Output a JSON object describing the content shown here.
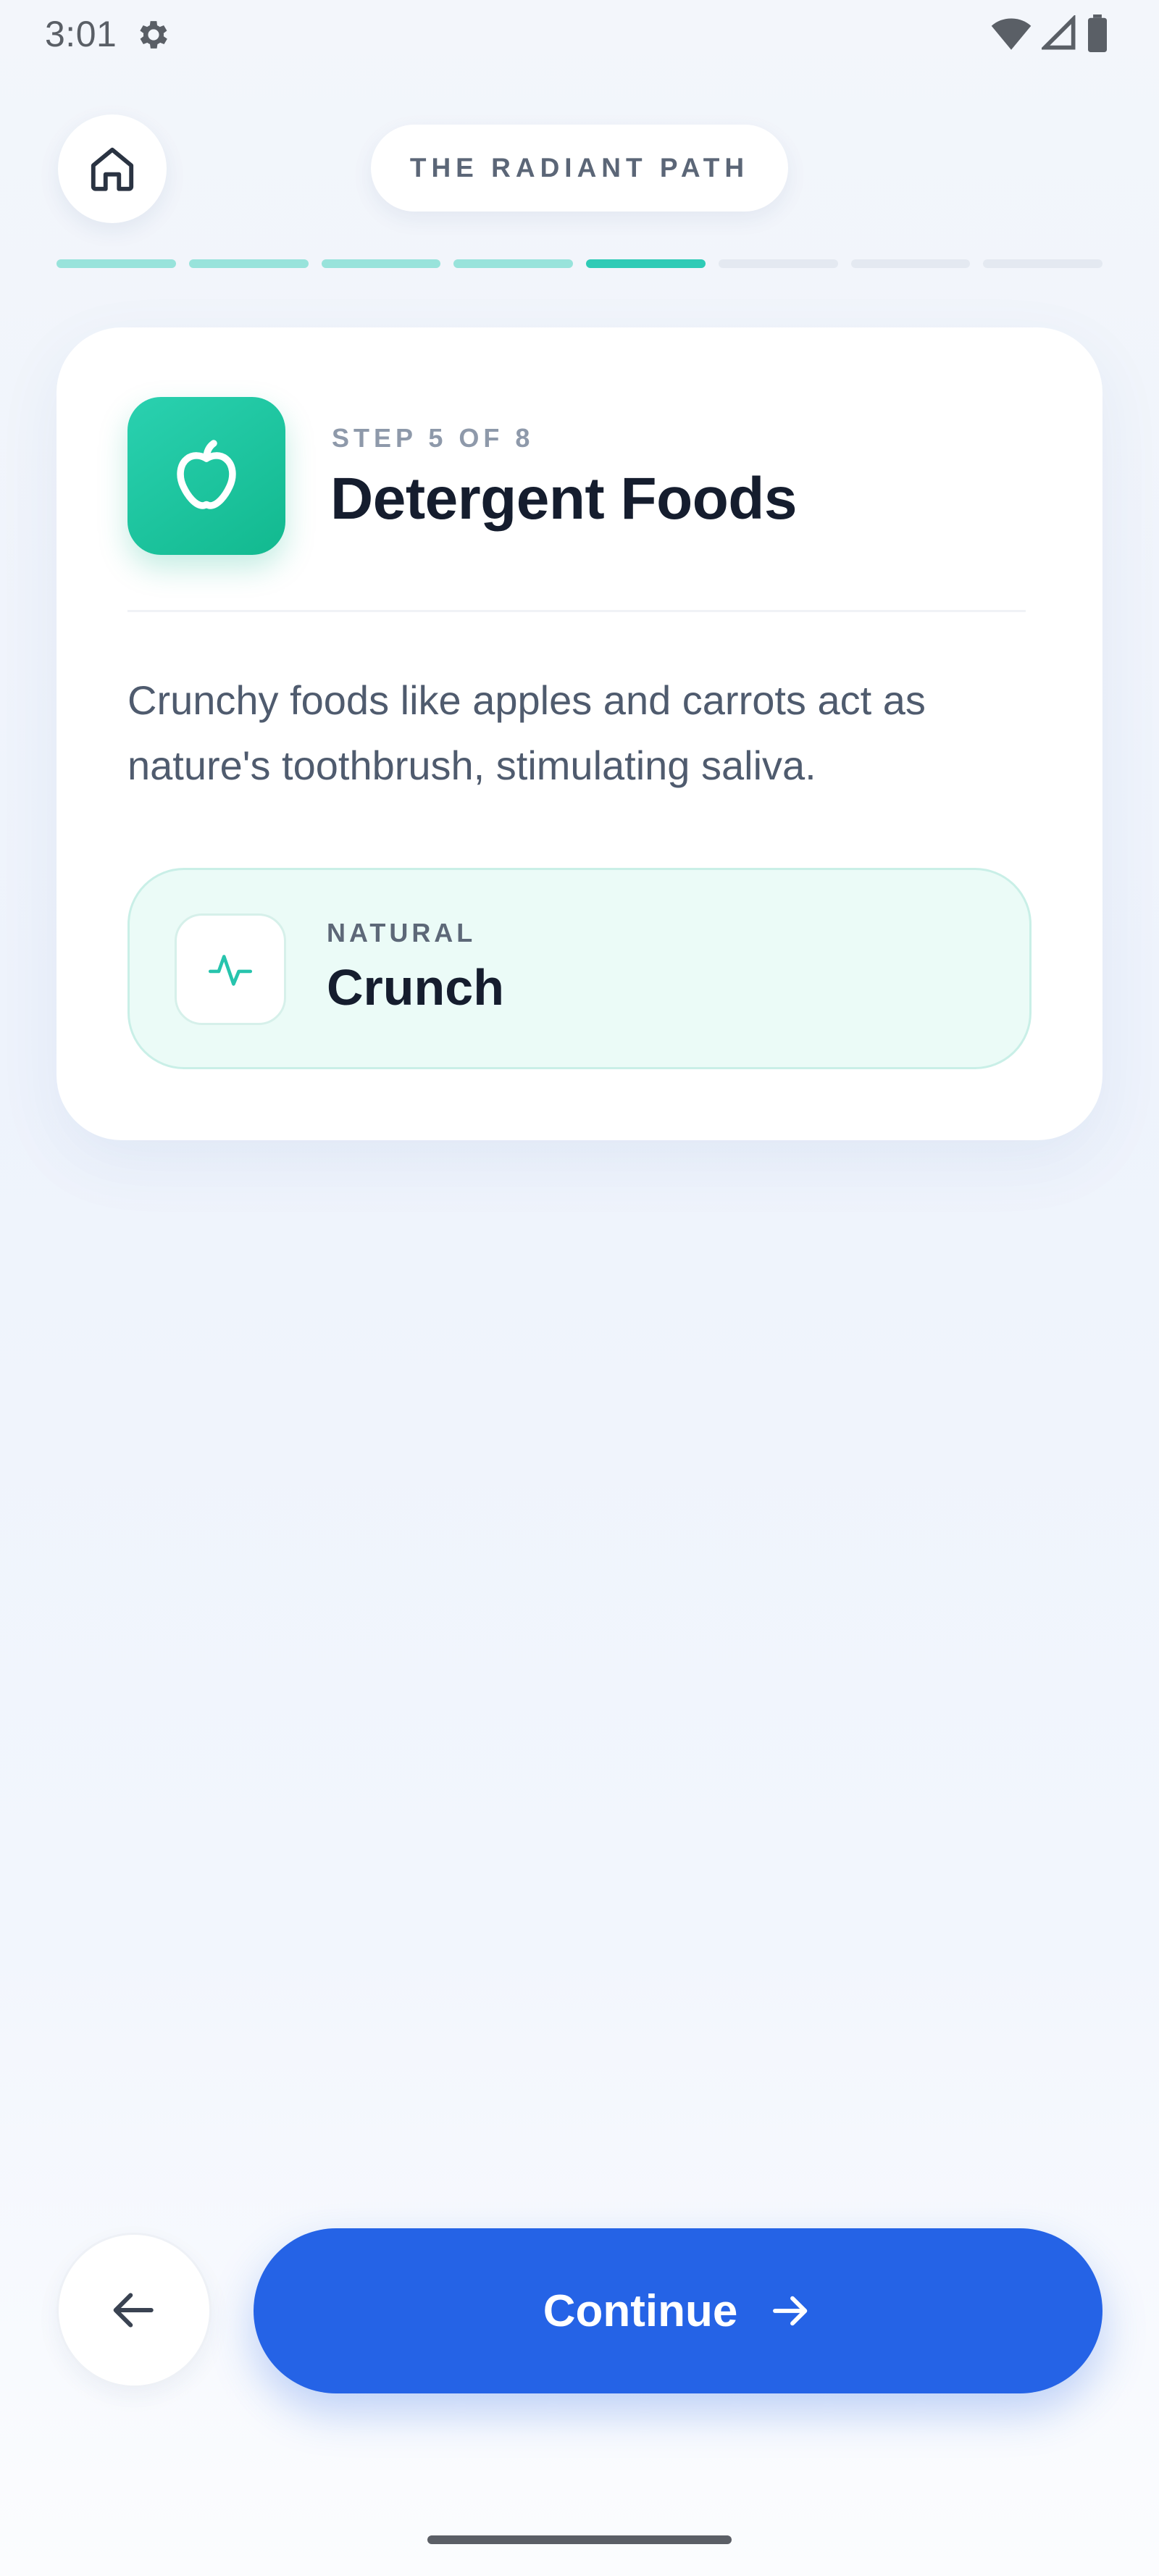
{
  "status_bar": {
    "time": "3:01",
    "icons": [
      "settings-gear-icon",
      "wifi-icon",
      "cellular-signal-icon",
      "battery-icon"
    ]
  },
  "header": {
    "home_icon": "home-icon",
    "brand": "THE RADIANT PATH"
  },
  "progress": {
    "total_steps": 8,
    "current_step": 5,
    "completed_color": "#98e3db",
    "current_color": "#2fcbb6",
    "pending_color": "#e4e9f1"
  },
  "card": {
    "icon": "apple-icon",
    "step_label": "STEP 5 OF 8",
    "title": "Detergent Foods",
    "body": "Crunchy foods like apples and carrots act as nature's toothbrush, stimulating saliva.",
    "fact": {
      "icon": "activity-pulse-icon",
      "label": "NATURAL",
      "value": "Crunch"
    }
  },
  "actions": {
    "back_icon": "arrow-left-icon",
    "continue_label": "Continue",
    "continue_icon": "arrow-right-icon",
    "primary_color": "#2563e6"
  }
}
